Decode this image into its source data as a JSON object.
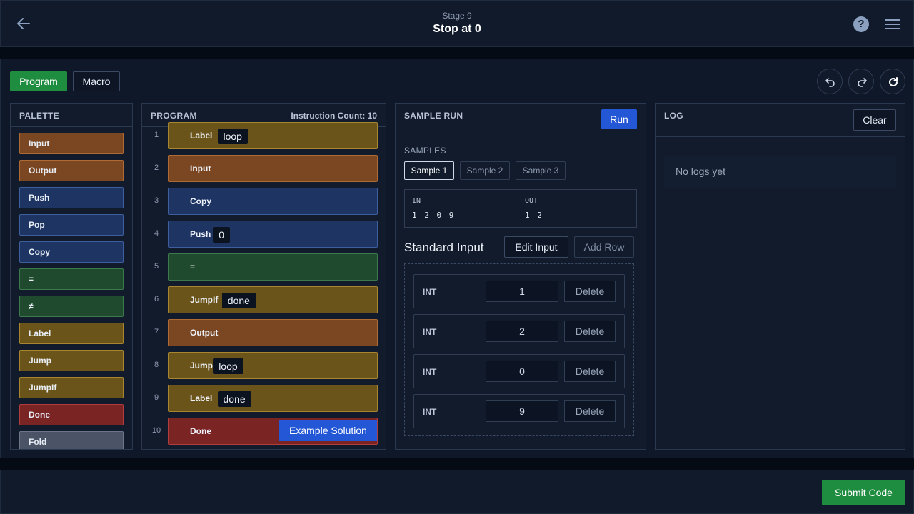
{
  "header": {
    "stage": "Stage 9",
    "title": "Stop at 0"
  },
  "modes": {
    "program": "Program",
    "macro": "Macro"
  },
  "palette": {
    "title": "PALETTE",
    "items": [
      {
        "label": "Input",
        "kind": "io"
      },
      {
        "label": "Output",
        "kind": "io"
      },
      {
        "label": "Push",
        "kind": "stack"
      },
      {
        "label": "Pop",
        "kind": "stack"
      },
      {
        "label": "Copy",
        "kind": "stack"
      },
      {
        "label": "=",
        "kind": "compare"
      },
      {
        "label": "≠",
        "kind": "compare"
      },
      {
        "label": "Label",
        "kind": "flow"
      },
      {
        "label": "Jump",
        "kind": "flow"
      },
      {
        "label": "JumpIf",
        "kind": "flow"
      },
      {
        "label": "Done",
        "kind": "done"
      },
      {
        "label": "Fold",
        "kind": "misc"
      }
    ]
  },
  "program": {
    "title": "PROGRAM",
    "count": "Instruction Count: 10",
    "example_button": "Example Solution",
    "lines": [
      {
        "num": "1",
        "op": "Label",
        "arg": "loop",
        "kind": "flow"
      },
      {
        "num": "2",
        "op": "Input",
        "arg": "",
        "kind": "io"
      },
      {
        "num": "3",
        "op": "Copy",
        "arg": "",
        "kind": "stack"
      },
      {
        "num": "4",
        "op": "Push",
        "arg": "0",
        "kind": "stack"
      },
      {
        "num": "5",
        "op": "=",
        "arg": "",
        "kind": "compare"
      },
      {
        "num": "6",
        "op": "JumpIf",
        "arg": "done",
        "kind": "flow"
      },
      {
        "num": "7",
        "op": "Output",
        "arg": "",
        "kind": "io"
      },
      {
        "num": "8",
        "op": "Jump",
        "arg": "loop",
        "kind": "flow"
      },
      {
        "num": "9",
        "op": "Label",
        "arg": "done",
        "kind": "flow"
      },
      {
        "num": "10",
        "op": "Done",
        "arg": "",
        "kind": "done"
      }
    ]
  },
  "sample_run": {
    "title": "SAMPLE RUN",
    "run_label": "Run",
    "samples_label": "SAMPLES",
    "tabs": [
      "Sample 1",
      "Sample 2",
      "Sample 3"
    ],
    "active_tab": 0,
    "in_label": "IN",
    "in_value": "1 2 0 9",
    "out_label": "OUT",
    "out_value": "1 2",
    "stdin_title": "Standard Input",
    "edit_input": "Edit Input",
    "add_row": "Add Row",
    "rows": [
      {
        "type": "INT",
        "value": "1",
        "delete": "Delete"
      },
      {
        "type": "INT",
        "value": "2",
        "delete": "Delete"
      },
      {
        "type": "INT",
        "value": "0",
        "delete": "Delete"
      },
      {
        "type": "INT",
        "value": "9",
        "delete": "Delete"
      }
    ]
  },
  "log": {
    "title": "LOG",
    "clear": "Clear",
    "empty": "No logs yet"
  },
  "footer": {
    "submit": "Submit Code"
  },
  "colors": {
    "io": {
      "bg": "#7a4722",
      "border": "#b06a33"
    },
    "stack": {
      "bg": "#1e3563",
      "border": "#3e5f9e"
    },
    "compare": {
      "bg": "#1f4a2d",
      "border": "#3c7a4d"
    },
    "flow": {
      "bg": "#6b5419",
      "border": "#a88530"
    },
    "done": {
      "bg": "#7a2424",
      "border": "#b13d3d"
    },
    "misc": {
      "bg": "#4a5466",
      "border": "#6a7689"
    }
  }
}
